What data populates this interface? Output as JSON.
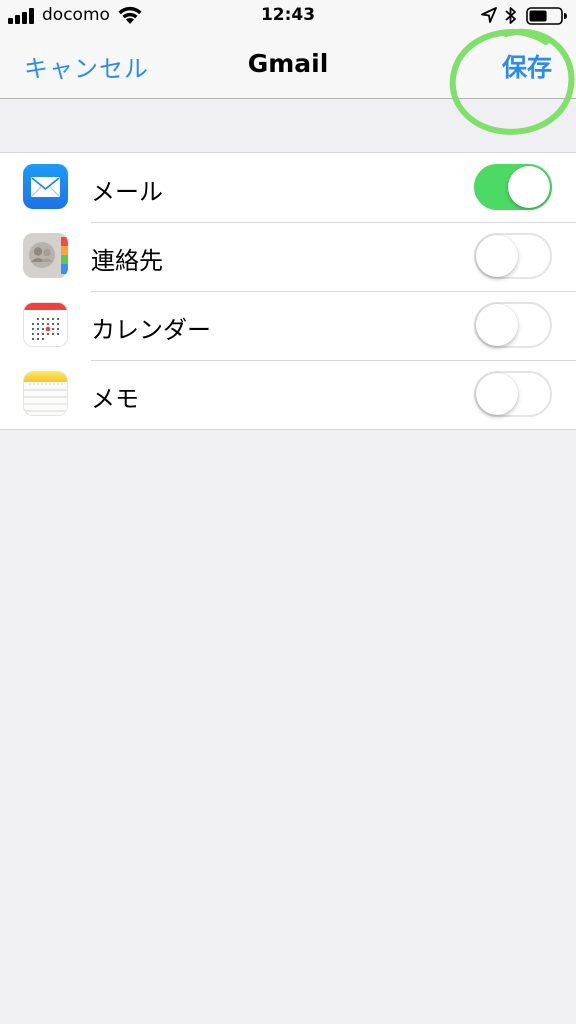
{
  "status_bar": {
    "carrier": "docomo",
    "time": "12:43",
    "signal_icon": "signal-bars-icon",
    "wifi_icon": "wifi-icon",
    "location_icon": "location-arrow-icon",
    "bluetooth_icon": "bluetooth-icon",
    "battery_icon": "battery-icon",
    "battery_level": 0.55
  },
  "nav": {
    "cancel_label": "キャンセル",
    "title": "Gmail",
    "save_label": "保存",
    "accent_color": "#2c8ceb",
    "annotation_color": "#7fe06a"
  },
  "services": [
    {
      "label": "メール",
      "icon": "mail-app-icon",
      "enabled": true
    },
    {
      "label": "連絡先",
      "icon": "contacts-app-icon",
      "enabled": false
    },
    {
      "label": "カレンダー",
      "icon": "calendar-app-icon",
      "enabled": false
    },
    {
      "label": "メモ",
      "icon": "notes-app-icon",
      "enabled": false
    }
  ],
  "colors": {
    "toggle_on": "#4cd964",
    "background": "#efeff4"
  }
}
